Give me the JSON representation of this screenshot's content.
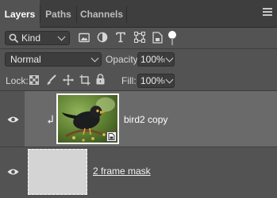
{
  "tabs": [
    {
      "label": "Layers"
    },
    {
      "label": "Paths"
    },
    {
      "label": "Channels"
    }
  ],
  "filter": {
    "kind_label": "Kind"
  },
  "blend_mode": {
    "value": "Normal"
  },
  "opacity": {
    "label": "Opacity:",
    "value": "100%"
  },
  "lock": {
    "label": "Lock:"
  },
  "fill": {
    "label": "Fill:",
    "value": "100%"
  },
  "layers": [
    {
      "name": "bird2 copy",
      "selected": true,
      "visible": true,
      "clipped": true,
      "smart_object": true
    },
    {
      "name": "2 frame mask",
      "selected": false,
      "visible": true,
      "clipped": false,
      "smart_object": false
    }
  ]
}
